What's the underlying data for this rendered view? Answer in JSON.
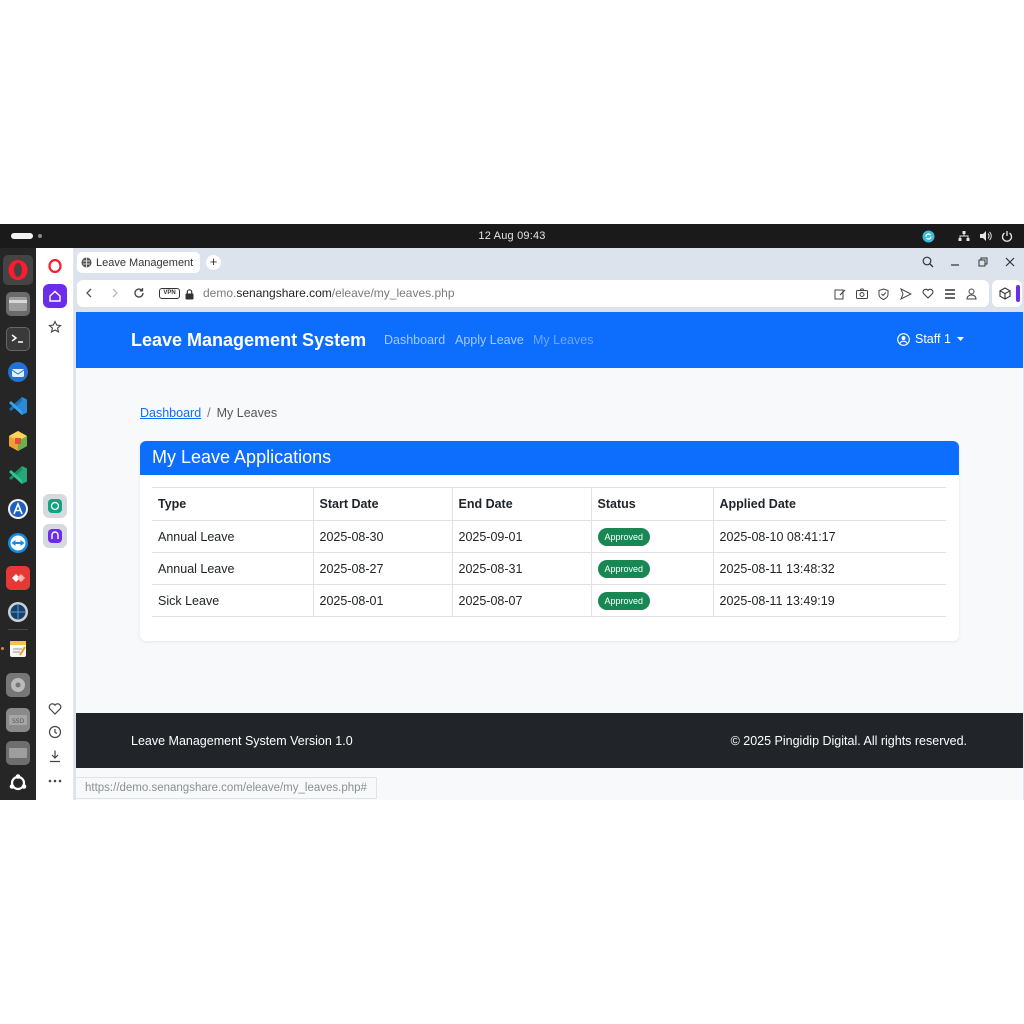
{
  "system": {
    "clock": "12 Aug  09:43"
  },
  "dock": {
    "items": [
      "opera",
      "files",
      "terminal",
      "thunderbird",
      "vscode",
      "blocks-app",
      "vscode-insiders",
      "app-center",
      "teamviewer",
      "anydesk",
      "web-browser",
      "text-editor",
      "disk-utility",
      "ssd-drive",
      "drive",
      "ubuntu-logo"
    ]
  },
  "browser": {
    "tab_title": "Leave Management",
    "new_tab": "+",
    "vpn_label": "VPN",
    "url_prefix": "demo.",
    "url_domain": "senangshare.com",
    "url_path": "/eleave/my_leaves.php",
    "status_url": "https://demo.senangshare.com/eleave/my_leaves.php#"
  },
  "navbar": {
    "brand": "Leave Management System",
    "links": [
      "Dashboard",
      "Apply Leave",
      "My Leaves"
    ],
    "active": "My Leaves",
    "user": "Staff 1"
  },
  "breadcrumb": {
    "home": "Dashboard",
    "separator": "/",
    "current": "My Leaves"
  },
  "card": {
    "title": "My Leave Applications"
  },
  "table": {
    "headers": [
      "Type",
      "Start Date",
      "End Date",
      "Status",
      "Applied Date"
    ],
    "rows": [
      {
        "type": "Annual Leave",
        "start": "2025-08-30",
        "end": "2025-09-01",
        "status": "Approved",
        "applied": "2025-08-10 08:41:17"
      },
      {
        "type": "Annual Leave",
        "start": "2025-08-27",
        "end": "2025-08-31",
        "status": "Approved",
        "applied": "2025-08-11 13:48:32"
      },
      {
        "type": "Sick Leave",
        "start": "2025-08-01",
        "end": "2025-08-07",
        "status": "Approved",
        "applied": "2025-08-11 13:49:19"
      }
    ]
  },
  "footer": {
    "left": "Leave Management System Version 1.0",
    "right": "© 2025 Pingidip Digital. All rights reserved."
  },
  "colors": {
    "primary": "#0d6efd",
    "success": "#198754",
    "footer": "#212529",
    "opera_red": "#ff1b2d",
    "opera_purple": "#6c2ceb"
  }
}
